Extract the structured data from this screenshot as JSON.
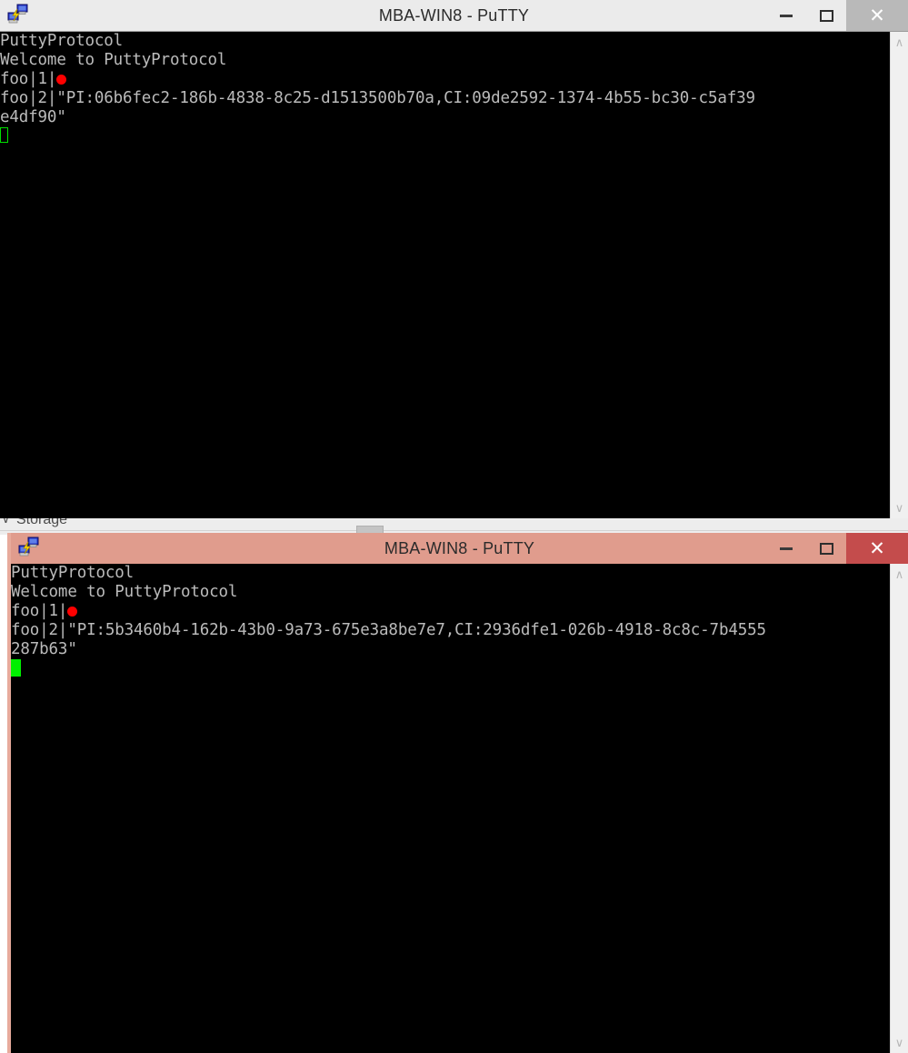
{
  "windows": {
    "back": {
      "title": "MBA-WIN8 - PuTTY",
      "icon": "putty-icon",
      "controls": {
        "minimize": "minimize-icon",
        "maximize": "maximize-icon",
        "close": "✕"
      },
      "state": "inactive",
      "titlebar_color": "#ebebeb",
      "close_color": "#b9b9b9",
      "terminal": {
        "background": "#000000",
        "foreground": "#bbbbbb",
        "cursor_color": "#00e000",
        "cursor_style": "hollow-block",
        "lines": [
          "PuttyProtocol",
          "Welcome to PuttyProtocol",
          "foo|1|",
          "foo|2|\"PI:06b6fec2-186b-4838-8c25-d1513500b70a,CI:09de2592-1374-4b55-bc30-c5af39",
          "e4df90\""
        ]
      },
      "scrollbar": {
        "up": "∧",
        "down": "∨"
      }
    },
    "front": {
      "title": "MBA-WIN8 - PuTTY",
      "icon": "putty-icon",
      "controls": {
        "minimize": "minimize-icon",
        "maximize": "maximize-icon",
        "close": "✕"
      },
      "state": "active",
      "titlebar_color": "#e09c8d",
      "close_color": "#c44c4c",
      "terminal": {
        "background": "#000000",
        "foreground": "#bbbbbb",
        "cursor_color": "#00f000",
        "cursor_style": "solid-block",
        "lines": [
          "PuttyProtocol",
          "Welcome to PuttyProtocol",
          "foo|1|",
          "foo|2|\"PI:5b3460b4-162b-43b0-9a73-675e3a8be7e7,CI:2936dfe1-026b-4918-8c8c-7b4555",
          "287b63\""
        ]
      },
      "scrollbar": {
        "up": "∧",
        "down": "∨"
      }
    }
  },
  "background_window": {
    "label": "Storage",
    "chevron": "∨"
  },
  "markers": {
    "red_dot_color": "#fe0000"
  }
}
